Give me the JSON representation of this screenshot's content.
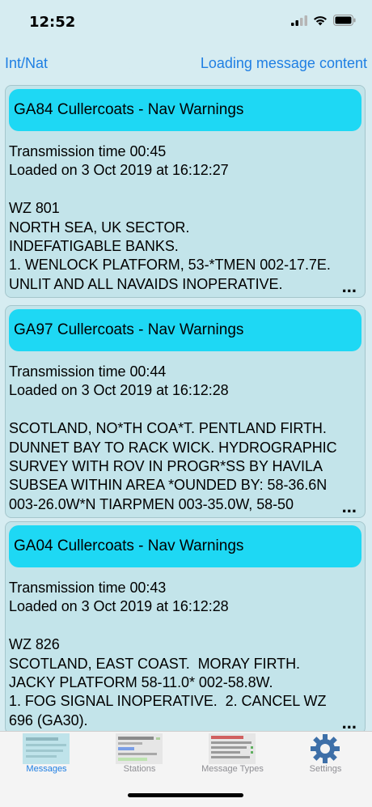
{
  "status": {
    "time": "12:52"
  },
  "nav": {
    "left_label": "Int/Nat",
    "right_label": "Loading message content"
  },
  "messages": [
    {
      "title": "GA84 Cullercoats - Nav Warnings",
      "body": "Transmission time 00:45\nLoaded on 3 Oct 2019 at 16:12:27\n\nWZ 801\nNORTH SEA, UK SECTOR.\nINDEFATIGABLE BANKS.\n1. WENLOCK PLATFORM, 53-*TMEN 002-17.7E.\nUNLIT AND ALL NAVAIDS INOPERATIVE.",
      "more": "..."
    },
    {
      "title": "GA97 Cullercoats - Nav Warnings",
      "body": "Transmission time 00:44\nLoaded on 3 Oct 2019 at 16:12:28\n\nSCOTLAND, NO*TH COA*T. PENTLAND FIRTH.\nDUNNET BAY TO RACK WICK. HYDROGRAPHIC\nSURVEY WITH ROV IN PROGR*SS BY HAVILA\nSUBSEA WITHIN AREA *OUNDED BY: 58-36.6N\n003-26.0W*N TIARPMEN 003-35.0W, 58-50",
      "more": "..."
    },
    {
      "title": "GA04 Cullercoats - Nav Warnings",
      "body": "Transmission time 00:43\nLoaded on 3 Oct 2019 at 16:12:28\n\nWZ 826\nSCOTLAND, EAST COAST.  MORAY FIRTH.\nJACKY PLATFORM 58-11.0* 002-58.8W.\n1. FOG SIGNAL INOPERATIVE.  2. CANCEL WZ\n696 (GA30).",
      "more": "..."
    }
  ],
  "tabs": [
    {
      "label": "Messages",
      "icon": "messages-tab-icon",
      "active": true
    },
    {
      "label": "Stations",
      "icon": "stations-tab-icon",
      "active": false
    },
    {
      "label": "Message Types",
      "icon": "message-types-tab-icon",
      "active": false
    },
    {
      "label": "Settings",
      "icon": "gear-icon",
      "active": false
    }
  ],
  "colors": {
    "background": "#d6ecf1",
    "card": "#c3e4ea",
    "card_header": "#1ed8f4",
    "accent": "#1f7fe3"
  }
}
